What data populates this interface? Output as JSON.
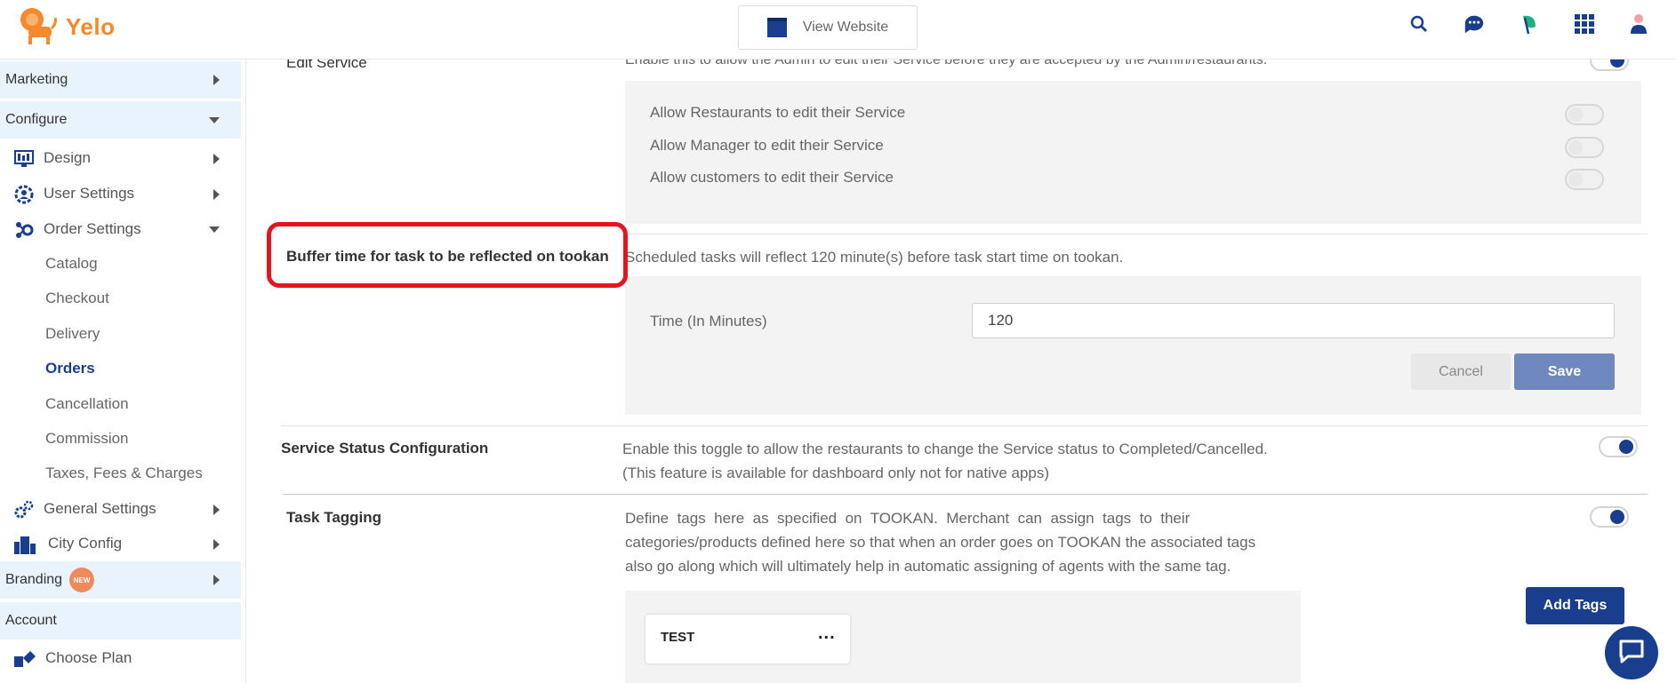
{
  "header": {
    "brand": "Yelo",
    "view_website": "View Website",
    "icons": [
      "search-icon",
      "support-chat-icon",
      "leaf-icon",
      "apps-grid-icon",
      "user-avatar-icon"
    ]
  },
  "sidebar": {
    "marketing": "Marketing",
    "configure": "Configure",
    "design": "Design",
    "user_settings": "User Settings",
    "order_settings": "Order Settings",
    "order_sub": [
      "Catalog",
      "Checkout",
      "Delivery",
      "Orders",
      "Cancellation",
      "Commission",
      "Taxes, Fees & Charges"
    ],
    "active_sub": "Orders",
    "general_settings": "General Settings",
    "city_config": "City Config",
    "branding": "Branding",
    "branding_badge": "NEW",
    "account": "Account",
    "choose_plan": "Choose Plan"
  },
  "edit_service": {
    "label": "Edit Service",
    "description": "Enable this to allow the Admin to edit their Service before they are accepted by the Admin/restaurants.",
    "enabled": true,
    "options": [
      {
        "label": "Allow Restaurants to edit their Service",
        "enabled": false
      },
      {
        "label": "Allow Manager to edit their Service",
        "enabled": false
      },
      {
        "label": "Allow customers to edit their Service",
        "enabled": false
      }
    ]
  },
  "buffer_time": {
    "label": "Buffer time for task to be reflected on tookan",
    "description": "Scheduled tasks will reflect 120 minute(s) before task start time on tookan.",
    "field_label": "Time (In Minutes)",
    "field_value": "120",
    "cancel": "Cancel",
    "save": "Save"
  },
  "service_status": {
    "label": "Service Status Configuration",
    "description_line1": "Enable this toggle to allow the restaurants to change the Service status to Completed/Cancelled.",
    "description_line2": "(This feature is available for dashboard only not for native apps)",
    "enabled": true
  },
  "task_tagging": {
    "label": "Task Tagging",
    "description_line1": "Define  tags  here  as  specified  on  TOOKAN.  Merchant  can  assign  tags  to  their",
    "description_line2": "categories/products defined here so that when an order goes on TOOKAN the associated tags",
    "description_line3": "also go along which will ultimately help in automatic assigning of agents with the same tag.",
    "enabled": true,
    "add_tags": "Add Tags",
    "tags": [
      "TEST"
    ],
    "more": "..."
  },
  "colors": {
    "accent": "#1a3e8e",
    "brand": "#f5892b",
    "highlight": "#e3161f"
  }
}
